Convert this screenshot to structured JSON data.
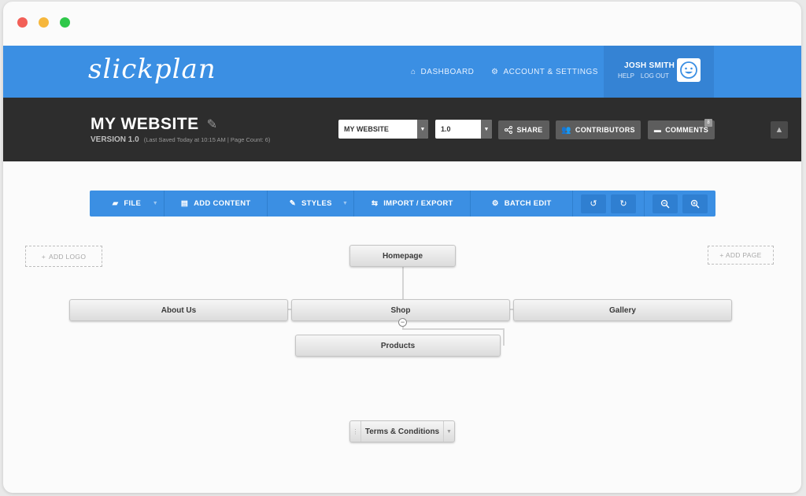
{
  "header": {
    "logo": "slickplan",
    "nav": [
      {
        "label": "DASHBOARD",
        "icon": "home-icon"
      },
      {
        "label": "ACCOUNT & SETTINGS",
        "icon": "gear-icon"
      }
    ],
    "user": {
      "name": "JOSH SMITH",
      "help": "HELP",
      "logout": "LOG OUT"
    }
  },
  "project": {
    "title": "MY WEBSITE",
    "version": "VERSION 1.0",
    "meta": "(Last Saved Today at 10:15 AM  |  Page Count: 6)",
    "site_select": "MY WEBSITE",
    "version_select": "1.0",
    "share": "SHARE",
    "contributors": "CONTRIBUTORS",
    "comments": "COMMENTS",
    "comments_badge": "8"
  },
  "toolbar": {
    "file": "FILE",
    "add_content": "ADD CONTENT",
    "styles": "STYLES",
    "import_export": "IMPORT / EXPORT",
    "batch_edit": "BATCH EDIT"
  },
  "canvas": {
    "add_logo": "ADD LOGO",
    "add_page": "+ ADD PAGE",
    "nodes": {
      "homepage": "Homepage",
      "about": "About Us",
      "shop": "Shop",
      "gallery": "Gallery",
      "products": "Products",
      "terms": "Terms & Conditions"
    }
  },
  "colors": {
    "primary": "#3b8fe3",
    "dark": "#2d2d2d",
    "window_red": "#f25f57",
    "window_yellow": "#f6b73c",
    "window_green": "#2fc84a"
  }
}
